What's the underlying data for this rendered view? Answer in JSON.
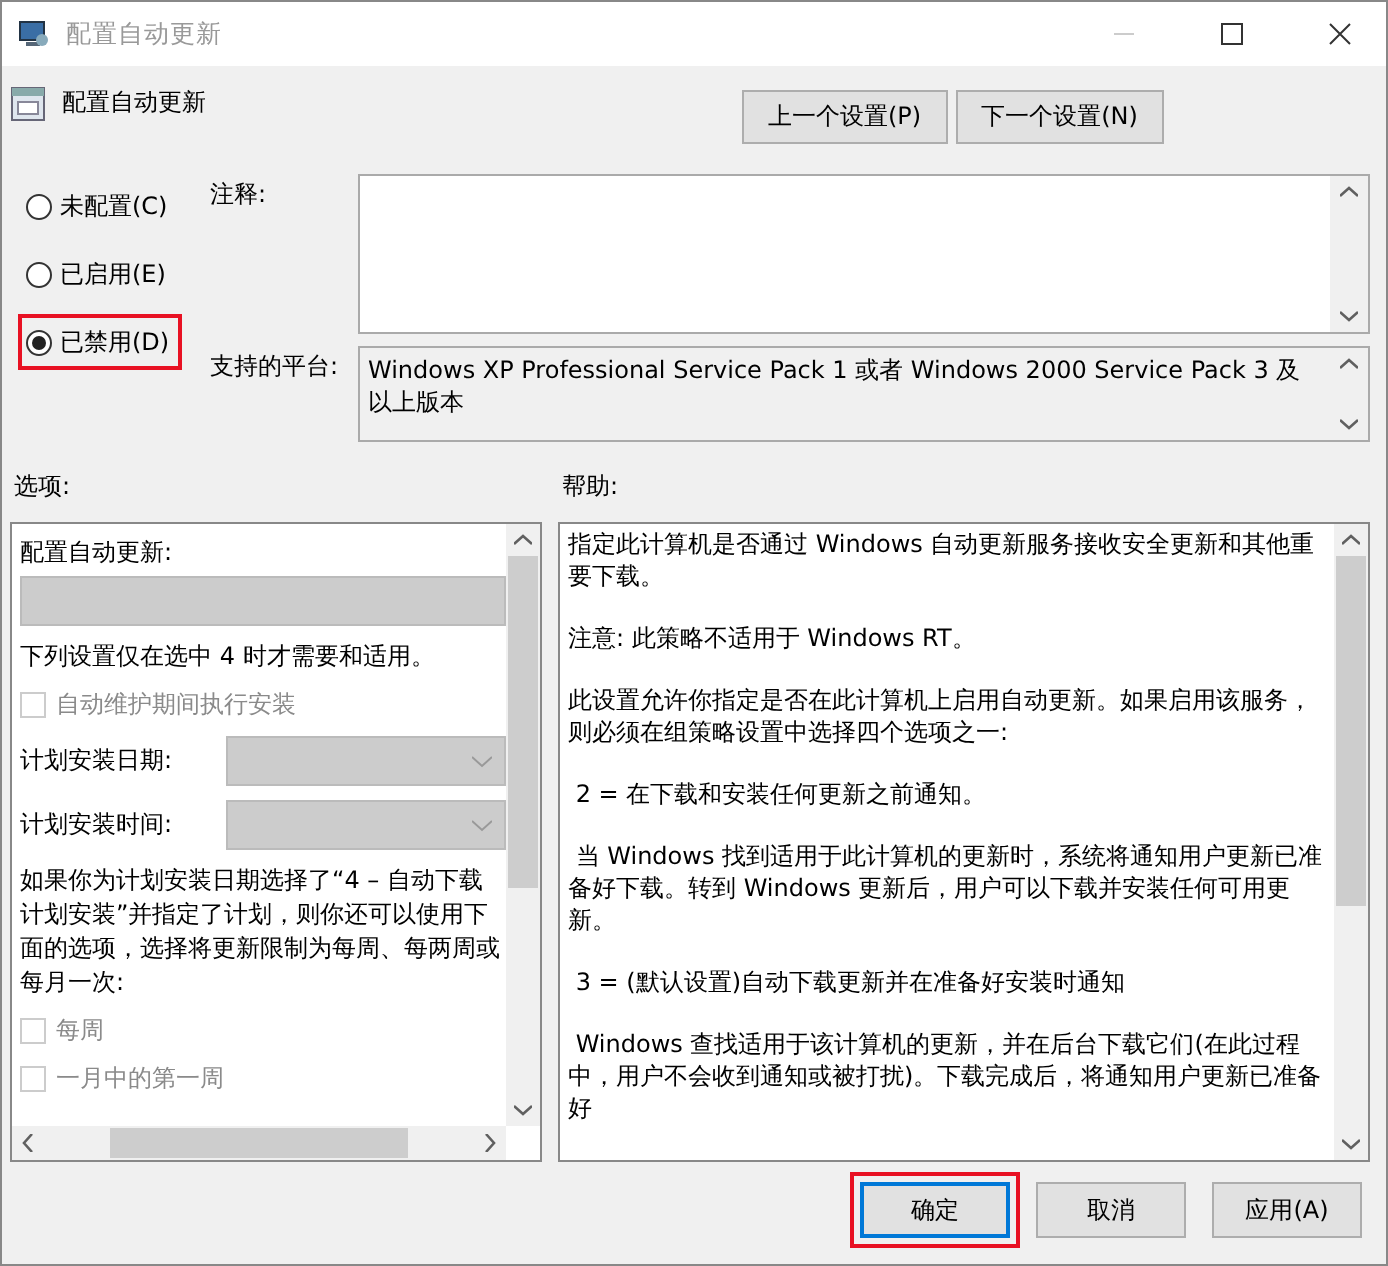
{
  "window": {
    "title": "配置自动更新"
  },
  "policy": {
    "name": "配置自动更新"
  },
  "nav_buttons": [
    {
      "label": "上一个设置(P)"
    },
    {
      "label": "下一个设置(N)"
    }
  ],
  "state_options": [
    {
      "label": "未配置(C)",
      "selected": false,
      "highlighted": false
    },
    {
      "label": "已启用(E)",
      "selected": false,
      "highlighted": false
    },
    {
      "label": "已禁用(D)",
      "selected": true,
      "highlighted": true
    }
  ],
  "comment": {
    "label": "注释:"
  },
  "platform": {
    "label": "支持的平台:",
    "text": "Windows XP Professional Service Pack 1 或者 Windows 2000 Service Pack 3 及以上版本"
  },
  "options": {
    "label": "选项:",
    "items": [
      {
        "kind": "heading",
        "text": "配置自动更新:"
      },
      {
        "kind": "select",
        "disabled": true
      },
      {
        "kind": "text",
        "text": "下列设置仅在选中 4 时才需要和适用。"
      },
      {
        "kind": "checkbox",
        "label": "自动维护期间执行安装",
        "checked": false,
        "disabled": true
      },
      {
        "kind": "labeled-select",
        "label": "计划安装日期:",
        "disabled": true
      },
      {
        "kind": "labeled-select",
        "label": "计划安装时间:",
        "disabled": true
      },
      {
        "kind": "text",
        "text": "如果你为计划安装日期选择了“4 – 自动下载计划安装”并指定了计划，则你还可以使用下面的选项，选择将更新限制为每周、每两周或每月一次:"
      },
      {
        "kind": "checkbox",
        "label": "每周",
        "checked": false,
        "disabled": true
      },
      {
        "kind": "checkbox",
        "label": "一月中的第一周",
        "checked": false,
        "disabled": true
      }
    ]
  },
  "help": {
    "label": "帮助:",
    "paragraphs": [
      "指定此计算机是否通过 Windows 自动更新服务接收安全更新和其他重要下载。",
      "注意: 此策略不适用于 Windows RT。",
      "此设置允许你指定是否在此计算机上启用自动更新。如果启用该服务，则必须在组策略设置中选择四个选项之一:",
      " 2 = 在下载和安装任何更新之前通知。",
      " 当 Windows 找到适用于此计算机的更新时，系统将通知用户更新已准备好下载。转到 Windows 更新后，用户可以下载并安装任何可用更新。",
      " 3 = (默认设置)自动下载更新并在准备好安装时通知",
      " Windows 查找适用于该计算机的更新，并在后台下载它们(在此过程中，用户不会收到通知或被打扰)。下载完成后，将通知用户更新已准备好"
    ]
  },
  "footer_buttons": [
    {
      "label": "确定",
      "focused": true,
      "highlighted": true
    },
    {
      "label": "取消",
      "focused": false,
      "highlighted": false
    },
    {
      "label": "应用(A)",
      "focused": false,
      "highlighted": false
    }
  ]
}
